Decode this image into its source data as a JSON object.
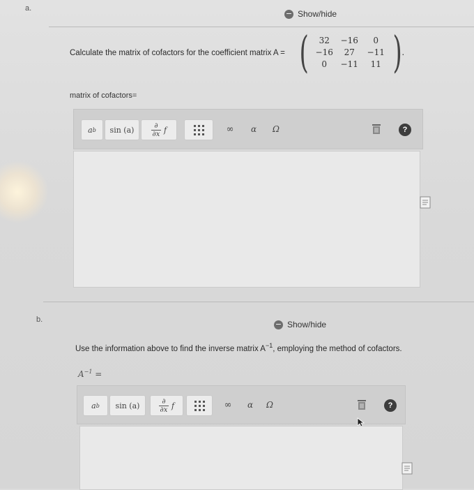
{
  "part_a": {
    "label": "a.",
    "showhide_label": "Show/hide",
    "question": "Calculate the matrix of cofactors for the coefficient matrix A =",
    "matrix": [
      [
        "32",
        "−16",
        "0"
      ],
      [
        "−16",
        "27",
        "−11"
      ],
      [
        "0",
        "−11",
        "11"
      ]
    ],
    "answer_label": "matrix of cofactors="
  },
  "part_b": {
    "label": "b.",
    "showhide_label": "Show/hide",
    "question_start": "Use the information above to find the inverse matrix A",
    "question_sup": "−1",
    "question_end": ", employing the method of cofactors.",
    "answer_label_base": "A",
    "answer_label_sup": "−1",
    "answer_label_eq": "="
  },
  "toolbar": {
    "power_base": "a",
    "power_exp": "b",
    "sin_label": "sin (a)",
    "deriv_num": "∂",
    "deriv_den": "∂x",
    "deriv_f": "f",
    "infinity": "∞",
    "alpha": "α",
    "omega": "Ω",
    "help": "?"
  },
  "colors": {
    "page": "#dcdcdc",
    "toolbar": "#cfcfcf",
    "answer_box": "#e9e9e9",
    "help_button": "#3d3d3d"
  }
}
